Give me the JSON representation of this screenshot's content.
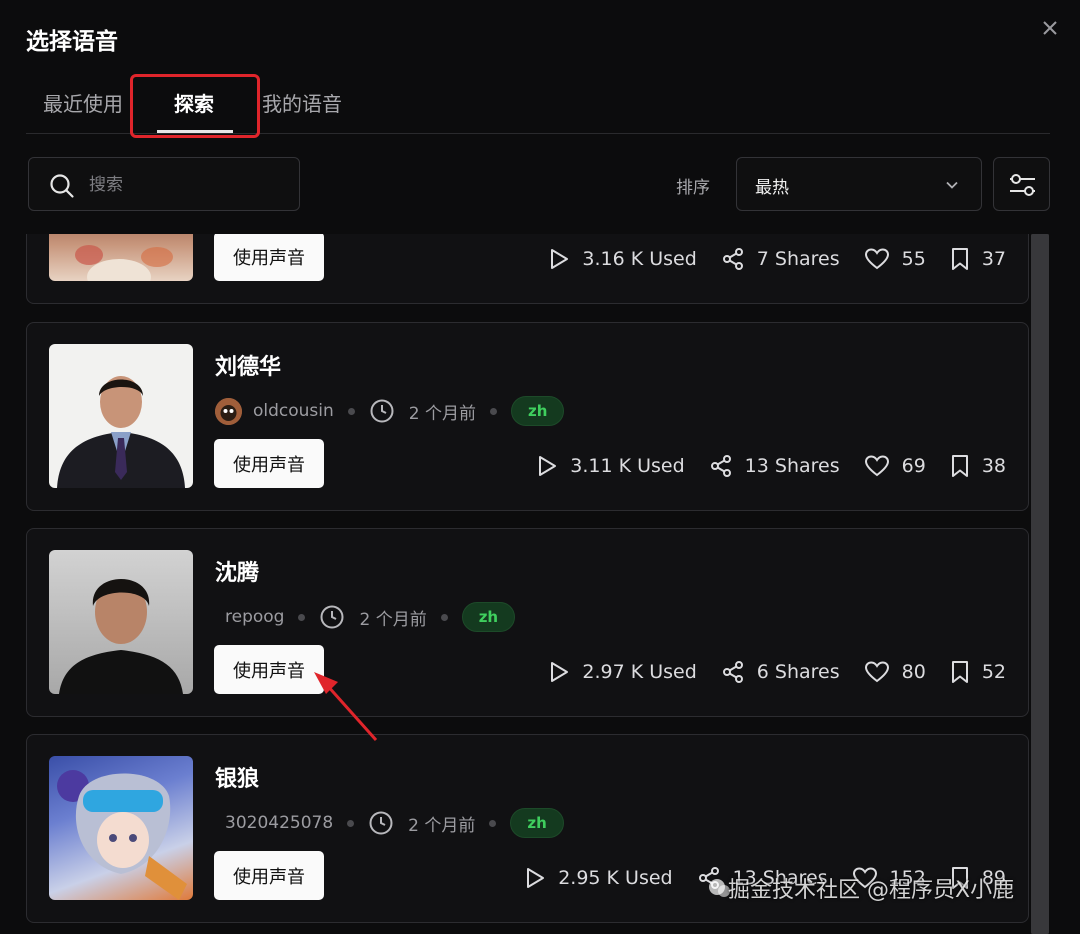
{
  "dialog": {
    "title": "选择语音"
  },
  "tabs": [
    {
      "label": "最近使用",
      "active": false
    },
    {
      "label": "探索",
      "active": true
    },
    {
      "label": "我的语音",
      "active": false
    }
  ],
  "search": {
    "placeholder": "搜索",
    "value": ""
  },
  "sort": {
    "label": "排序",
    "selected": "最热"
  },
  "colors": {
    "accent": "#3fcf5e",
    "highlight": "#e0252b",
    "background": "#0c0c0d"
  },
  "icons": [
    "close-icon",
    "search-icon",
    "chevron-down-icon",
    "filter-icon",
    "clock-icon",
    "play-icon",
    "share-icon",
    "heart-icon",
    "bookmark-icon"
  ],
  "cards": [
    {
      "name": "",
      "author": "",
      "time": "",
      "lang": "",
      "use_label": "使用声音",
      "used": "3.16 K Used",
      "shares": "7 Shares",
      "likes": "55",
      "saves": "37"
    },
    {
      "name": "刘德华",
      "author": "oldcousin",
      "time": "2 个月前",
      "lang": "zh",
      "use_label": "使用声音",
      "used": "3.11 K Used",
      "shares": "13 Shares",
      "likes": "69",
      "saves": "38"
    },
    {
      "name": "沈腾",
      "author": "repoog",
      "time": "2 个月前",
      "lang": "zh",
      "use_label": "使用声音",
      "used": "2.97 K Used",
      "shares": "6 Shares",
      "likes": "80",
      "saves": "52"
    },
    {
      "name": "银狼",
      "author": "3020425078",
      "time": "2 个月前",
      "lang": "zh",
      "use_label": "使用声音",
      "used": "2.95 K Used",
      "shares": "13 Shares",
      "likes": "152",
      "saves": "89"
    }
  ],
  "watermark": "掘金技术社区 @程序员X小鹿"
}
